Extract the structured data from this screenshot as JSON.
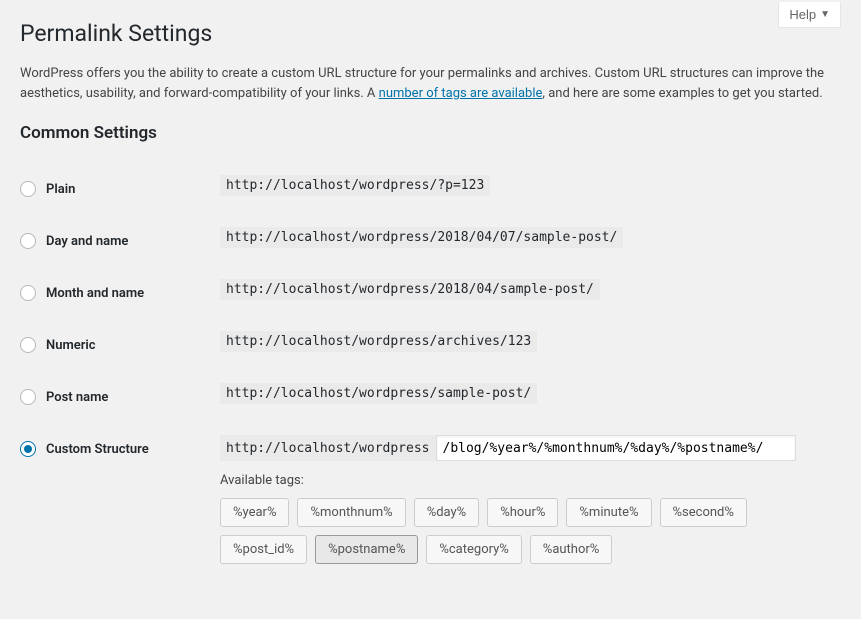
{
  "help_button": "Help",
  "page_title": "Permalink Settings",
  "intro_part1": "WordPress offers you the ability to create a custom URL structure for your permalinks and archives. Custom URL structures can improve the aesthetics, usability, and forward-compatibility of your links. A ",
  "intro_link": "number of tags are available",
  "intro_part2": ", and here are some examples to get you started.",
  "common_settings_heading": "Common Settings",
  "options": {
    "plain": {
      "label": "Plain",
      "example": "http://localhost/wordpress/?p=123"
    },
    "day_name": {
      "label": "Day and name",
      "example": "http://localhost/wordpress/2018/04/07/sample-post/"
    },
    "month_name": {
      "label": "Month and name",
      "example": "http://localhost/wordpress/2018/04/sample-post/"
    },
    "numeric": {
      "label": "Numeric",
      "example": "http://localhost/wordpress/archives/123"
    },
    "post_name": {
      "label": "Post name",
      "example": "http://localhost/wordpress/sample-post/"
    },
    "custom": {
      "label": "Custom Structure",
      "prefix": "http://localhost/wordpress",
      "value": "/blog/%year%/%monthnum%/%day%/%postname%/"
    }
  },
  "available_tags_label": "Available tags:",
  "tags": {
    "year": "%year%",
    "monthnum": "%monthnum%",
    "day": "%day%",
    "hour": "%hour%",
    "minute": "%minute%",
    "second": "%second%",
    "post_id": "%post_id%",
    "postname": "%postname%",
    "category": "%category%",
    "author": "%author%"
  }
}
